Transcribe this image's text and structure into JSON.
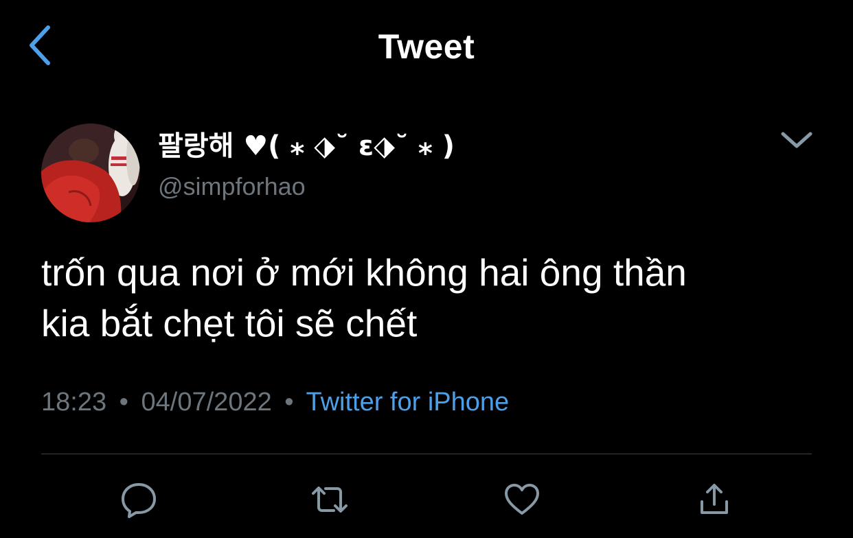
{
  "header": {
    "title": "Tweet",
    "back_icon": "chevron-left-icon",
    "accent_color": "#4d9fe8"
  },
  "tweet": {
    "author": {
      "display_name": "팔랑해 ♥︎( ⁎ ⬗˘ ε⬗˘ ⁎ )",
      "handle": "@simpforhao",
      "avatar": "avatar-image"
    },
    "menu_icon": "chevron-down-icon",
    "text": "trốn qua nơi ở mới không hai ông thần\nkia bắt chẹt tôi sẽ chết",
    "time": "18:23",
    "date": "04/07/2022",
    "separator": "•",
    "source": "Twitter for iPhone"
  },
  "actions": [
    {
      "name": "reply",
      "icon": "reply-icon"
    },
    {
      "name": "retweet",
      "icon": "retweet-icon"
    },
    {
      "name": "like",
      "icon": "heart-icon"
    },
    {
      "name": "share",
      "icon": "share-icon"
    }
  ],
  "colors": {
    "background": "#000000",
    "text": "#ffffff",
    "muted": "#6e767d",
    "link": "#4d9fe8",
    "icon": "#8899a6",
    "divider": "#3d4247"
  }
}
